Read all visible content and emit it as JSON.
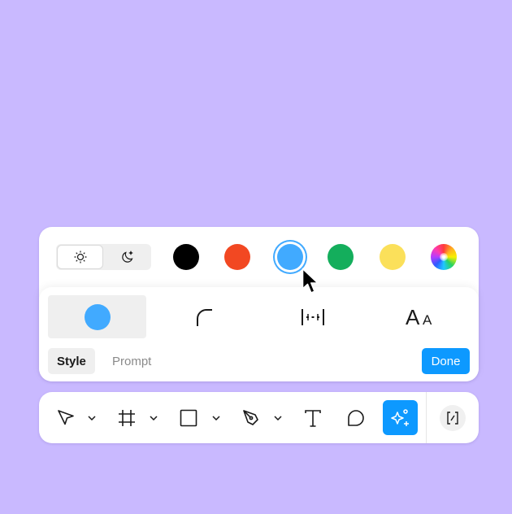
{
  "theme_toggle": {
    "light_icon": "sun-icon",
    "dark_icon": "moon-icon",
    "selected": "light"
  },
  "colors": [
    {
      "name": "black",
      "hex": "#000000"
    },
    {
      "name": "red",
      "hex": "#f24822"
    },
    {
      "name": "blue",
      "hex": "#41aaff",
      "selected": true
    },
    {
      "name": "green",
      "hex": "#14ae5c"
    },
    {
      "name": "yellow",
      "hex": "#fbe05a"
    },
    {
      "name": "rainbow",
      "hex": "multicolor"
    }
  ],
  "style_options": [
    {
      "icon": "fill-color-icon",
      "selected": true
    },
    {
      "icon": "corner-radius-icon"
    },
    {
      "icon": "spacing-icon"
    },
    {
      "icon": "typography-icon",
      "label": "AA"
    }
  ],
  "tabs": [
    {
      "label": "Style",
      "active": true
    },
    {
      "label": "Prompt",
      "active": false
    }
  ],
  "done_label": "Done",
  "toolbar": {
    "tools": [
      "move-icon",
      "frame-icon",
      "rectangle-icon",
      "pen-icon",
      "text-icon",
      "comment-icon",
      "ai-sparkle-icon",
      "dev-mode-icon"
    ],
    "accent": "#0d99ff"
  }
}
